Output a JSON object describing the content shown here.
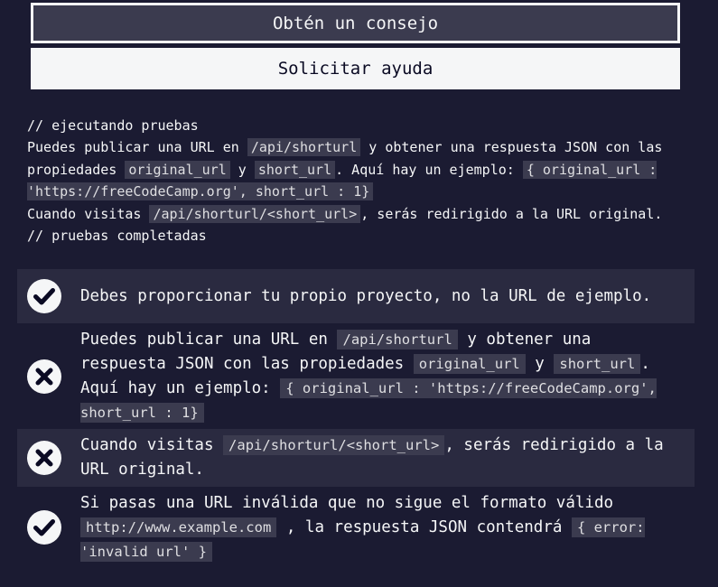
{
  "buttons": {
    "hint": "Obtén un consejo",
    "help": "Solicitar ayuda"
  },
  "console": {
    "start": "// ejecutando pruebas",
    "line1_a": "Puedes publicar una URL en ",
    "line1_code1": "/api/shorturl",
    "line1_b": " y obtener una respuesta JSON con las propiedades ",
    "line1_code2": "original_url",
    "line1_c": " y ",
    "line1_code3": "short_url",
    "line1_d": ". Aquí hay un ejemplo: ",
    "line1_code4": "{ original_url : 'https://freeCodeCamp.org', short_url : 1}",
    "line2_a": "Cuando visitas ",
    "line2_code": "/api/shorturl/<short_url>",
    "line2_b": ", serás redirigido a la URL original.",
    "end": "// pruebas completadas"
  },
  "tests": [
    {
      "status": "pass",
      "icon": "check-circle-icon",
      "text": "Debes proporcionar tu propio proyecto, no la URL de ejemplo."
    },
    {
      "status": "fail",
      "icon": "x-circle-icon",
      "a": "Puedes publicar una URL en ",
      "code1": "/api/shorturl",
      "b": " y obtener una respuesta JSON con las propiedades ",
      "code2": "original_url",
      "c": " y ",
      "code3": "short_url",
      "d": ". Aquí hay un ejemplo: ",
      "code4": "{ original_url : 'https://freeCodeCamp.org', short_url : 1}"
    },
    {
      "status": "fail",
      "icon": "x-circle-icon",
      "a": "Cuando visitas ",
      "code1": "/api/shorturl/<short_url>",
      "b": ", serás redirigido a la URL original."
    },
    {
      "status": "pass",
      "icon": "check-circle-icon",
      "a": "Si pasas una URL inválida que no sigue el formato válido ",
      "code1": "http://www.example.com",
      "b": " , la respuesta JSON contendrá ",
      "code2": "{ error: 'invalid url' }"
    }
  ],
  "colors": {
    "background": "#1b1b32",
    "shaded_row": "#2a2a40",
    "code_bg": "#3b3b4f",
    "text": "#f5f6f7"
  }
}
